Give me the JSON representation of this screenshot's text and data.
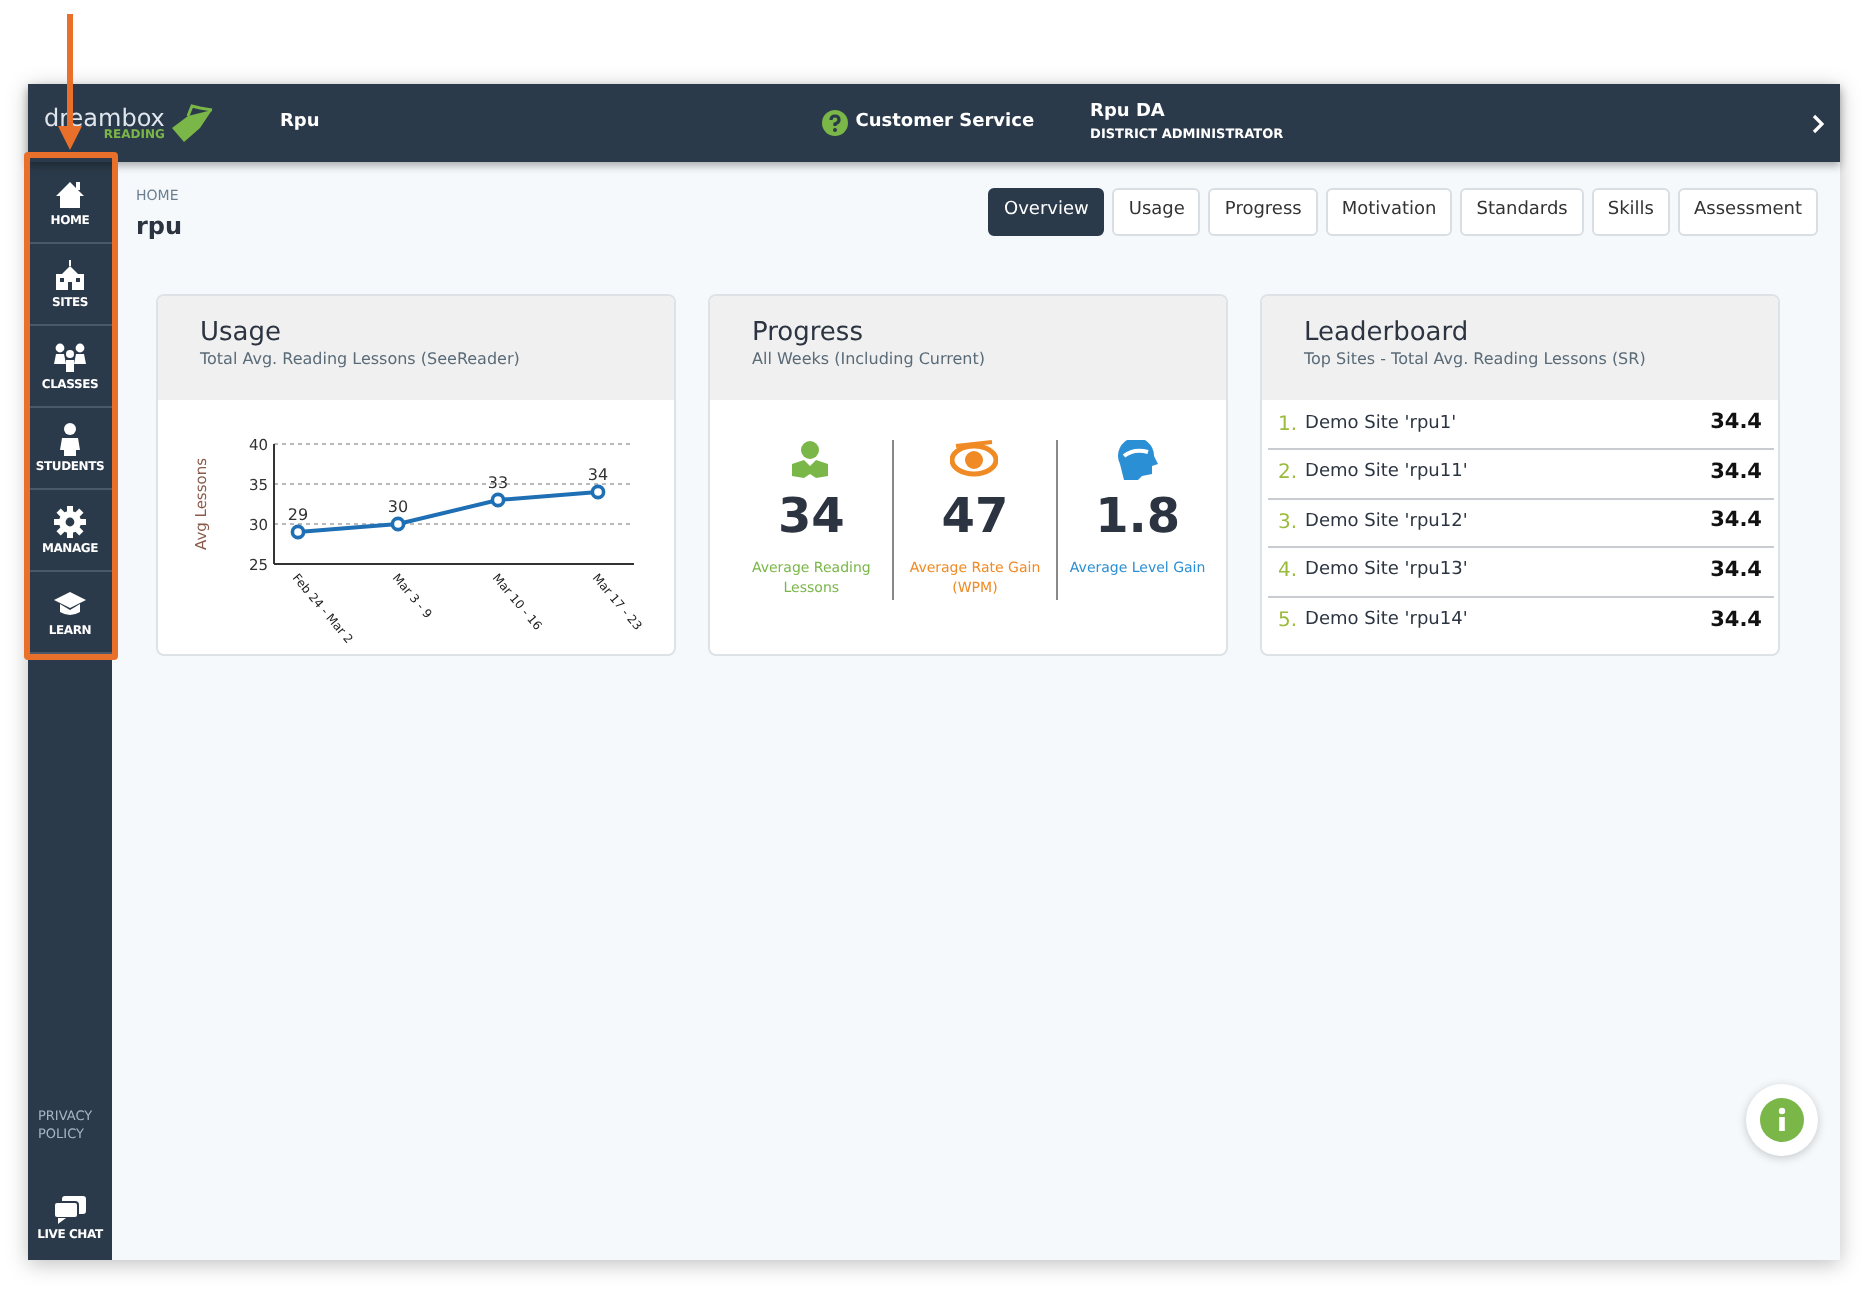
{
  "header": {
    "logo_text": "dreambox",
    "logo_subtext": "READING",
    "district": "Rpu",
    "customer_service": "Customer Service",
    "user_name": "Rpu DA",
    "user_role": "DISTRICT ADMINISTRATOR"
  },
  "sidebar": {
    "items": [
      {
        "label": "HOME"
      },
      {
        "label": "SITES"
      },
      {
        "label": "CLASSES"
      },
      {
        "label": "STUDENTS"
      },
      {
        "label": "MANAGE"
      },
      {
        "label": "LEARN"
      }
    ],
    "privacy": "PRIVACY POLICY",
    "live_chat": "LIVE CHAT"
  },
  "breadcrumb": "HOME",
  "page_title": "rpu",
  "tabs": [
    {
      "label": "Overview",
      "selected": true
    },
    {
      "label": "Usage",
      "selected": false
    },
    {
      "label": "Progress",
      "selected": false
    },
    {
      "label": "Motivation",
      "selected": false
    },
    {
      "label": "Standards",
      "selected": false
    },
    {
      "label": "Skills",
      "selected": false
    },
    {
      "label": "Assessment",
      "selected": false
    }
  ],
  "usage": {
    "title": "Usage",
    "subtitle": "Total Avg. Reading Lessons (SeeReader)",
    "chart_data": {
      "type": "line",
      "ylabel": "Avg Lessons",
      "categories": [
        "Feb 24 - Mar 2",
        "Mar 3 - 9",
        "Mar 10 - 16",
        "Mar 17 - 23"
      ],
      "series": [
        {
          "color": "#1f6fb5",
          "marker": true,
          "values": [
            29,
            30,
            33,
            34
          ]
        }
      ],
      "ylim": [
        25,
        40
      ],
      "yticks": [
        25,
        30,
        35,
        40
      ],
      "data_labels": true
    }
  },
  "progress": {
    "title": "Progress",
    "subtitle": "All Weeks (Including Current)",
    "metrics": [
      {
        "value": "34",
        "label": "Average Reading Lessons",
        "color": "#7ab648"
      },
      {
        "value": "47",
        "label": "Average Rate Gain (WPM)",
        "color": "#f08a24"
      },
      {
        "value": "1.8",
        "label": "Average Level Gain",
        "color": "#2a8fd4"
      }
    ]
  },
  "leaderboard": {
    "title": "Leaderboard",
    "subtitle": "Top Sites - Total Avg. Reading Lessons (SR)",
    "rows": [
      {
        "rank": "1.",
        "name": "Demo Site 'rpu1'",
        "value": "34.4"
      },
      {
        "rank": "2.",
        "name": "Demo Site 'rpu11'",
        "value": "34.4"
      },
      {
        "rank": "3.",
        "name": "Demo Site 'rpu12'",
        "value": "34.4"
      },
      {
        "rank": "4.",
        "name": "Demo Site 'rpu13'",
        "value": "34.4"
      },
      {
        "rank": "5.",
        "name": "Demo Site 'rpu14'",
        "value": "34.4"
      }
    ]
  }
}
